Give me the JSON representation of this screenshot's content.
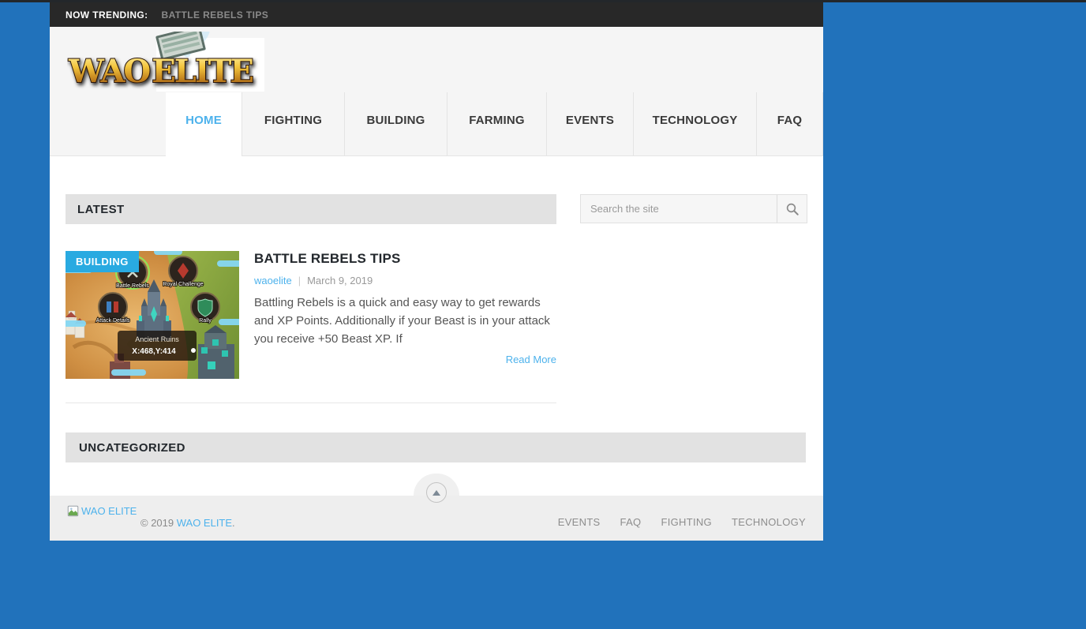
{
  "topbar": {
    "label": "NOW TRENDING:",
    "trending_post": "BATTLE REBELS TIPS"
  },
  "logo": {
    "title": "WAO ELITE",
    "part1": "WAO",
    "part2": "ELITE"
  },
  "nav": {
    "items": [
      {
        "label": "HOME",
        "active": true
      },
      {
        "label": "FIGHTING",
        "active": false
      },
      {
        "label": "BUILDING",
        "active": false
      },
      {
        "label": "FARMING",
        "active": false
      },
      {
        "label": "EVENTS",
        "active": false
      },
      {
        "label": "TECHNOLOGY",
        "active": false
      },
      {
        "label": "FAQ",
        "active": false
      }
    ]
  },
  "main": {
    "latest_heading": "LATEST",
    "uncategorized_heading": "UNCATEGORIZED",
    "search": {
      "placeholder": "Search the site"
    },
    "post": {
      "category_badge": "BUILDING",
      "title": "BATTLE REBELS TIPS",
      "author": "waoelite",
      "meta_separator": "|",
      "date": "March 9, 2019",
      "excerpt": "Battling Rebels is a quick and easy way to get rewards and XP Points. Additionally if your Beast is in your attack you receive +50 Beast XP. If",
      "read_more": "Read More",
      "thumbnail": {
        "labels": [
          "Battle Rebels",
          "Royal Challenge",
          "Attack Details",
          "Rally"
        ],
        "location_name": "Ancient Ruins",
        "coordinates": "X:468,Y:414"
      }
    }
  },
  "footer": {
    "logo_alt": "WAO ELITE",
    "copyright_prefix": "© 2019 ",
    "copyright_link": "WAO ELITE",
    "copyright_suffix": ".",
    "nav": [
      "EVENTS",
      "FAQ",
      "FIGHTING",
      "TECHNOLOGY"
    ]
  },
  "icons": {
    "search": "magnifier",
    "scroll_top": "up-arrow",
    "footer_logo": "broken-image",
    "logo_book": "spell-book"
  },
  "colors": {
    "page_background": "#2172bb",
    "topbar_background": "#282828",
    "header_background": "#f5f5f5",
    "accent_link": "#4db2ec",
    "category_badge": "#29aae1",
    "section_bar": "#e2e2e2",
    "footer_background": "#eeeeee",
    "body_text": "#555555"
  }
}
